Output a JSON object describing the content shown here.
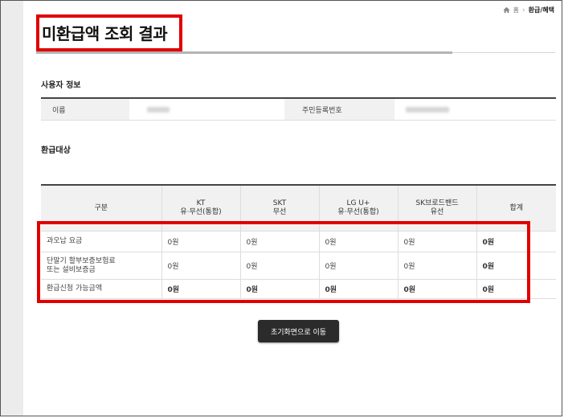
{
  "breadcrumb": {
    "home": "홈",
    "current": "환급/혜택"
  },
  "page": {
    "title": "미환급액 조회 결과"
  },
  "user_info": {
    "section_title": "사용자 정보",
    "name_label": "이름",
    "id_label": "주민등록번호"
  },
  "refund": {
    "section_title": "환급대상",
    "headers": [
      {
        "line1": "구분",
        "line2": ""
      },
      {
        "line1": "KT",
        "line2": "유·무선(통합)"
      },
      {
        "line1": "SKT",
        "line2": "무선"
      },
      {
        "line1": "LG U+",
        "line2": "유·무선(통합)"
      },
      {
        "line1": "SK브로드밴드",
        "line2": "유선"
      },
      {
        "line1": "합계",
        "line2": ""
      }
    ],
    "rows": [
      {
        "label": "과오납 요금",
        "label2": "",
        "values": [
          "0원",
          "0원",
          "0원",
          "0원",
          "0원"
        ]
      },
      {
        "label": "단말기 할부보증보험료",
        "label2": "또는 설비보증금",
        "values": [
          "0원",
          "0원",
          "0원",
          "0원",
          "0원"
        ]
      },
      {
        "label": "환급신청 가능금액",
        "label2": "",
        "values": [
          "0원",
          "0원",
          "0원",
          "0원",
          "0원"
        ]
      }
    ]
  },
  "buttons": {
    "reset": "초기화면으로 이동"
  },
  "colors": {
    "highlight": "#e00000",
    "header_bg": "#f1f1f1",
    "button_bg": "#2b2b2b"
  }
}
